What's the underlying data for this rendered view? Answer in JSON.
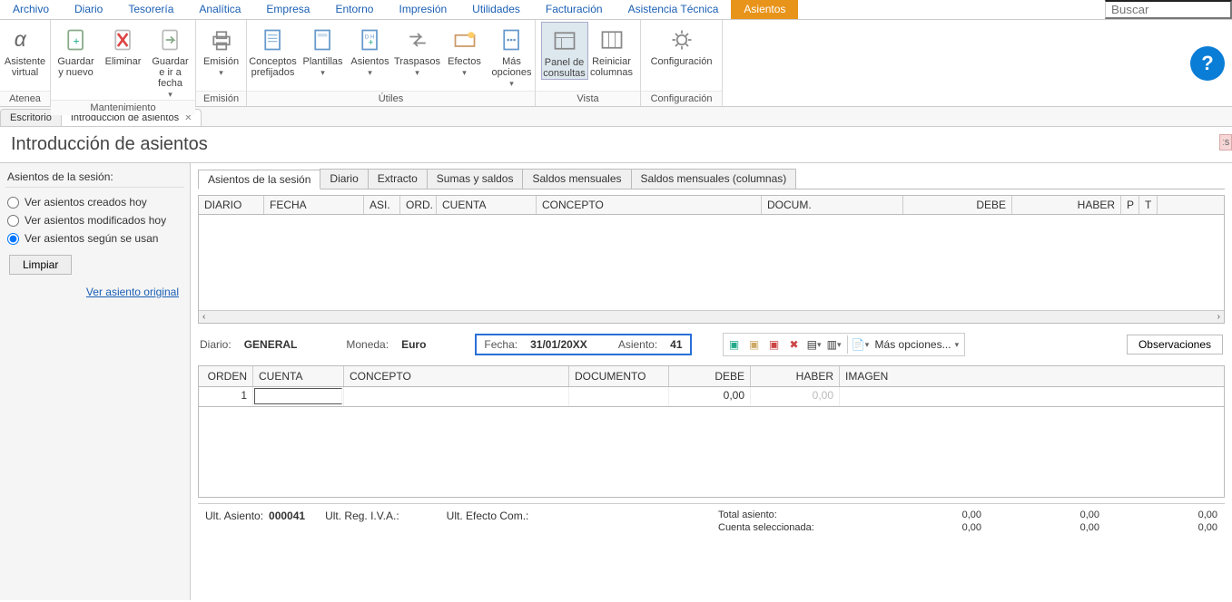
{
  "menubar": {
    "items": [
      "Archivo",
      "Diario",
      "Tesorería",
      "Analítica",
      "Empresa",
      "Entorno",
      "Impresión",
      "Utilidades",
      "Facturación",
      "Asistencia Técnica",
      "Asientos"
    ],
    "active_index": 10,
    "search_placeholder": "Buscar"
  },
  "ribbon": {
    "groups": [
      {
        "label": "Atenea",
        "buttons": [
          {
            "label": "Asistente virtual"
          }
        ]
      },
      {
        "label": "Mantenimiento",
        "buttons": [
          {
            "label": "Guardar y nuevo"
          },
          {
            "label": "Eliminar"
          },
          {
            "label": "Guardar e ir a fecha",
            "dropdown": true
          }
        ]
      },
      {
        "label": "Emisión",
        "buttons": [
          {
            "label": "Emisión",
            "dropdown": true
          }
        ]
      },
      {
        "label": "Útiles",
        "buttons": [
          {
            "label": "Conceptos prefijados"
          },
          {
            "label": "Plantillas",
            "dropdown": true
          },
          {
            "label": "Asientos",
            "dropdown": true
          },
          {
            "label": "Traspasos",
            "dropdown": true
          },
          {
            "label": "Efectos",
            "dropdown": true
          },
          {
            "label": "Más opciones",
            "dropdown": true
          }
        ]
      },
      {
        "label": "Vista",
        "buttons": [
          {
            "label": "Panel de consultas",
            "active": true
          },
          {
            "label": "Reiniciar columnas"
          }
        ]
      },
      {
        "label": "Configuración",
        "buttons": [
          {
            "label": "Configuración"
          }
        ]
      }
    ]
  },
  "doc_tabs": [
    {
      "label": "Escritorio",
      "closable": false
    },
    {
      "label": "Introducción de asientos",
      "closable": true,
      "active": true
    }
  ],
  "page_title": "Introducción de asientos",
  "left_panel": {
    "title": "Asientos de la sesión:",
    "radios": [
      {
        "label": "Ver asientos creados hoy",
        "checked": false
      },
      {
        "label": "Ver asientos modificados hoy",
        "checked": false
      },
      {
        "label": "Ver asientos según se usan",
        "checked": true
      }
    ],
    "clear_btn": "Limpiar",
    "link": "Ver asiento original"
  },
  "session_tabs": [
    {
      "label": "Asientos de la sesión",
      "active": true
    },
    {
      "label": "Diario"
    },
    {
      "label": "Extracto"
    },
    {
      "label": "Sumas y saldos"
    },
    {
      "label": "Saldos mensuales"
    },
    {
      "label": "Saldos mensuales (columnas)"
    }
  ],
  "session_grid_cols": [
    "DIARIO",
    "FECHA",
    "ASI.",
    "ORD.",
    "CUENTA",
    "CONCEPTO",
    "DOCUM.",
    "DEBE",
    "HABER",
    "P",
    "T"
  ],
  "entry_bar": {
    "diario_lbl": "Diario:",
    "diario_val": "GENERAL",
    "moneda_lbl": "Moneda:",
    "moneda_val": "Euro",
    "fecha_lbl": "Fecha:",
    "fecha_val": "31/01/20XX",
    "asiento_lbl": "Asiento:",
    "asiento_val": "41",
    "mas_opciones": "Más opciones...",
    "observaciones": "Observaciones"
  },
  "entry_grid_cols": [
    "ORDEN",
    "CUENTA",
    "CONCEPTO",
    "DOCUMENTO",
    "DEBE",
    "HABER",
    "IMAGEN"
  ],
  "entry_row": {
    "orden": "1",
    "debe": "0,00",
    "haber": "0,00"
  },
  "status": {
    "ult_asiento_lbl": "Ult. Asiento:",
    "ult_asiento_val": "000041",
    "ult_reg_iva_lbl": "Ult. Reg. I.V.A.:",
    "ult_efecto_lbl": "Ult. Efecto Com.:",
    "total_asiento_lbl": "Total asiento:",
    "cuenta_sel_lbl": "Cuenta seleccionada:",
    "zeros": "0,00"
  },
  "edge_tab": "ːs"
}
